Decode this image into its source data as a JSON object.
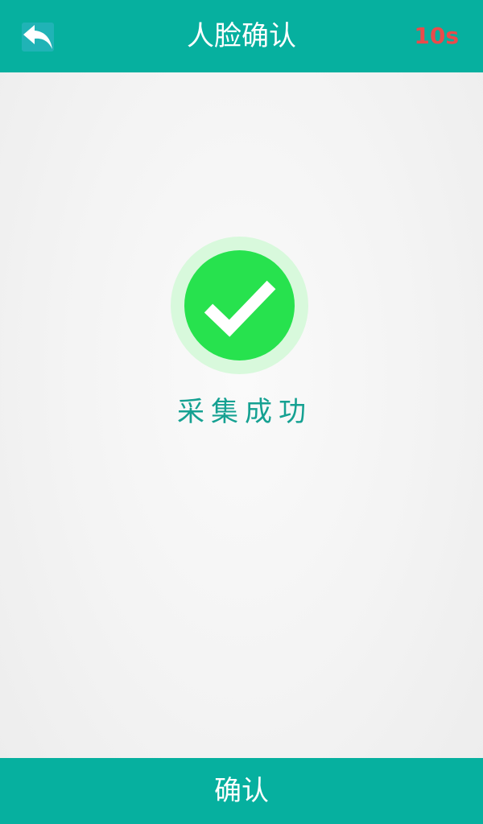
{
  "header": {
    "title": "人脸确认",
    "countdown": "10s",
    "back_icon": "reply-arrow-icon"
  },
  "main": {
    "status_icon": "check-circle-icon",
    "status_text": "采集成功"
  },
  "footer": {
    "confirm_label": "确认"
  },
  "colors": {
    "primary": "#06b09f",
    "success": "#27e24e",
    "success_halo": "#d8f9dc",
    "status_text": "#15a192",
    "countdown": "#e94b4b"
  }
}
